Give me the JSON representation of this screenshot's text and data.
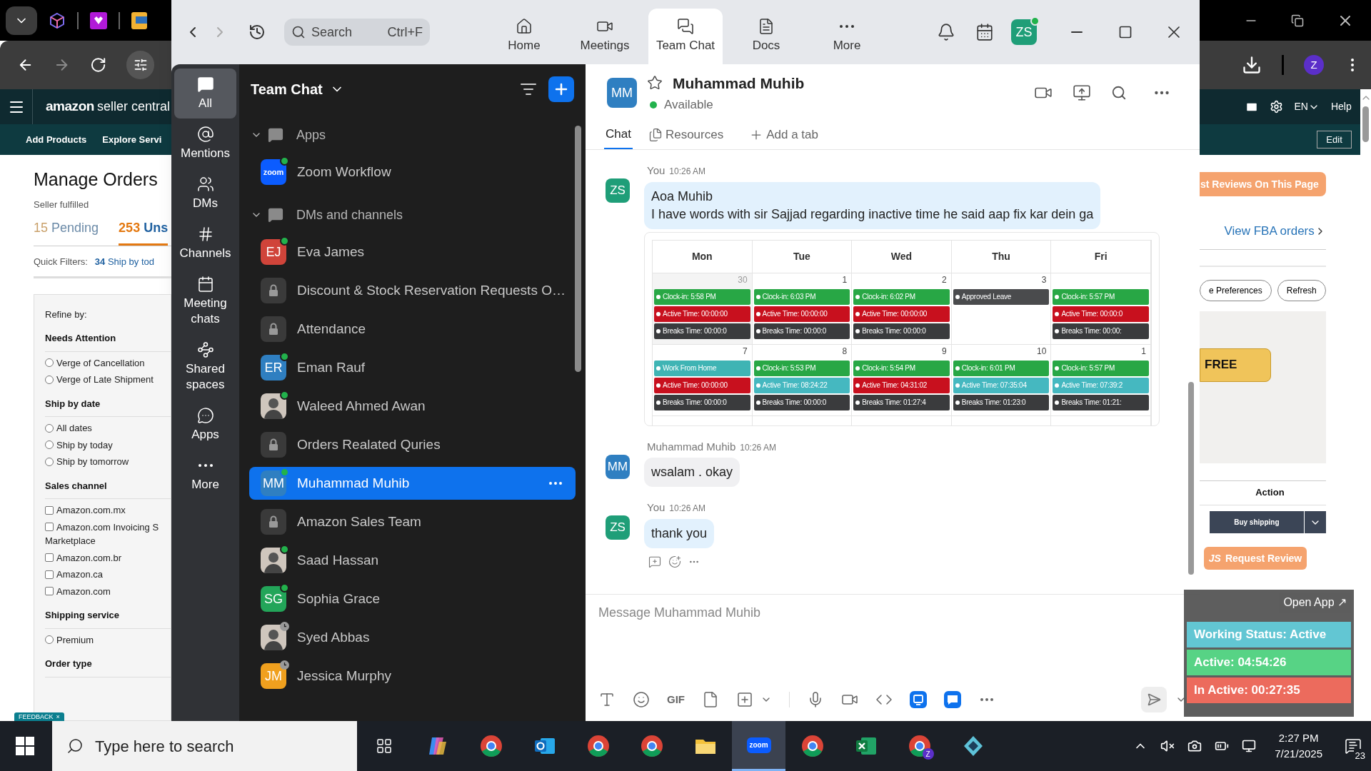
{
  "browser": {
    "brand": "amazon",
    "product": "seller central",
    "nav_links": [
      "Add Products",
      "Explore Servi"
    ],
    "language": "EN",
    "help": "Help",
    "edit_button": "Edit",
    "page_title": "Manage Orders",
    "subtitle": "Seller fulfilled",
    "order_tabs": [
      {
        "count": "15",
        "label": "Pending",
        "selected": false
      },
      {
        "count": "253",
        "label": "Uns",
        "selected": true
      }
    ],
    "quick_filters_label": "Quick Filters:",
    "quick_filter": {
      "count": "34",
      "label": "Ship by tod"
    },
    "refine_title": "Refine by:",
    "filter_groups": [
      {
        "title": "Needs Attention",
        "kind": "radio",
        "options": [
          {
            "label": "Verge of Cancellation",
            "checked": false
          },
          {
            "label": "Verge of Late Shipment",
            "checked": false
          }
        ]
      },
      {
        "title": "Ship by date",
        "kind": "radio",
        "options": [
          {
            "label": "All dates",
            "checked": false
          },
          {
            "label": "Ship by today",
            "checked": false
          },
          {
            "label": "Ship by tomorrow",
            "checked": false
          }
        ]
      },
      {
        "title": "Sales channel",
        "kind": "checkbox",
        "options": [
          {
            "label": "Amazon.com.mx",
            "checked": false
          },
          {
            "label": "Amazon.com Invoicing S",
            "continuation": "Marketplace",
            "checked": false
          },
          {
            "label": "Amazon.com.br",
            "checked": false
          },
          {
            "label": "Amazon.ca",
            "checked": false
          },
          {
            "label": "Amazon.com",
            "checked": false
          }
        ]
      },
      {
        "title": "Shipping service",
        "kind": "radio",
        "options": [
          {
            "label": "Premium",
            "checked": false
          }
        ]
      },
      {
        "title": "Order type"
      }
    ],
    "feedback_tab": {
      "label": "FEEDBACK",
      "close": "×"
    },
    "reviews_button": "st Reviews On This Page",
    "fba_link": "View FBA orders",
    "pill_buttons": [
      "e Preferences",
      "Refresh"
    ],
    "promo_button": "FREE",
    "action_header": "Action",
    "profile_initial": "Z",
    "buy_shipping": "Buy shipping",
    "request_review": {
      "badge": "JS",
      "label": "Request Review"
    }
  },
  "widget": {
    "open_app": "Open App ↗",
    "rows": [
      {
        "label": "Working Status: Active",
        "color": "#62c6d3"
      },
      {
        "label": "Active: 04:54:26",
        "color": "#57d385"
      },
      {
        "label": "In Active: 00:27:35",
        "color": "#ec6b5d"
      }
    ]
  },
  "zoom": {
    "search": {
      "placeholder": "Search",
      "shortcut": "Ctrl+F"
    },
    "nav_tabs": [
      {
        "label": "Home",
        "kind": "home",
        "selected": false
      },
      {
        "label": "Meetings",
        "kind": "meetings",
        "selected": false
      },
      {
        "label": "Team Chat",
        "kind": "team_chat",
        "selected": true
      },
      {
        "label": "Docs",
        "kind": "docs",
        "selected": false
      },
      {
        "label": "More",
        "kind": "more",
        "selected": false
      }
    ],
    "user": {
      "initials": "ZS",
      "online": true
    },
    "rail": [
      {
        "label": "All",
        "kind": "all",
        "selected": true
      },
      {
        "label": "Mentions",
        "kind": "mentions",
        "selected": false
      },
      {
        "label": "DMs",
        "kind": "dms",
        "selected": false
      },
      {
        "label": "Channels",
        "kind": "channels",
        "selected": false
      },
      {
        "label": "Meeting chats",
        "kind": "meeting_chats",
        "selected": false
      },
      {
        "label": "Shared spaces",
        "kind": "shared_spaces",
        "selected": false
      },
      {
        "label": "Apps",
        "kind": "apps",
        "selected": false
      },
      {
        "label": "More",
        "kind": "more",
        "selected": false
      }
    ],
    "list_title": "Team Chat",
    "sections": [
      {
        "title": "Apps",
        "expanded": true,
        "items": [
          {
            "name": "Zoom Workflow",
            "kind": "app",
            "avatar_text": "zoom",
            "online": true,
            "selected": false
          }
        ]
      },
      {
        "title": "DMs and channels",
        "expanded": true,
        "items": [
          {
            "name": "Eva James",
            "kind": "initials",
            "initials": "EJ",
            "color": "#d0443a",
            "online": true,
            "selected": false
          },
          {
            "name": "Discount & Stock Reservation Requests O…",
            "kind": "lock",
            "selected": false
          },
          {
            "name": "Attendance",
            "kind": "lock",
            "selected": false
          },
          {
            "name": "Eman Rauf",
            "kind": "initials",
            "initials": "ER",
            "color": "#2f7fc1",
            "online": true,
            "selected": false
          },
          {
            "name": "Waleed Ahmed Awan",
            "kind": "photo",
            "online": true,
            "selected": false
          },
          {
            "name": "Orders Realated Quries",
            "kind": "lock",
            "selected": false
          },
          {
            "name": "Muhammad Muhib",
            "kind": "initials",
            "initials": "MM",
            "color": "#2f7fc1",
            "online": true,
            "selected": true
          },
          {
            "name": "Amazon Sales Team",
            "kind": "lock",
            "selected": false
          },
          {
            "name": "Saad Hassan",
            "kind": "photo",
            "online": true,
            "selected": false
          },
          {
            "name": "Sophia Grace",
            "kind": "initials",
            "initials": "SG",
            "color": "#23a559",
            "online": true,
            "selected": false
          },
          {
            "name": "Syed Abbas",
            "kind": "photo",
            "away": true,
            "selected": false
          },
          {
            "name": "Jessica Murphy",
            "kind": "initials",
            "initials": "JM",
            "color": "#f0a01e",
            "away": true,
            "selected": false
          }
        ]
      }
    ],
    "chat": {
      "contact": {
        "initials": "MM",
        "color": "#2f7fc1",
        "name": "Muhammad Muhib",
        "status": "Available",
        "starred": false
      },
      "tabs": [
        {
          "label": "Chat",
          "kind": "chat",
          "selected": true
        },
        {
          "label": "Resources",
          "kind": "resources",
          "selected": false
        },
        {
          "label": "Add a tab",
          "kind": "add",
          "selected": false
        }
      ],
      "messages": [
        {
          "sender": "You",
          "time": "10:26 AM",
          "initials": "ZS",
          "color": "#1f9e78",
          "mine": true,
          "lines": [
            "Aoa Muhib",
            "I have words with sir Sajjad regarding inactive time he said aap fix kar dein ga"
          ],
          "attachment": {
            "days": [
              "Mon",
              "Tue",
              "Wed",
              "Thu",
              "Fri"
            ],
            "weeks": [
              [
                {
                  "date": "30",
                  "other_month": true,
                  "events": [
                    {
                      "text": "Clock-in: 5:58 PM",
                      "color": "#28a745"
                    },
                    {
                      "text": "Active Time: 00:00:00",
                      "color": "#c8101e"
                    },
                    {
                      "text": "Breaks Time: 00:00:0",
                      "color": "#3a3b3d"
                    }
                  ]
                },
                {
                  "date": "1",
                  "events": [
                    {
                      "text": "Clock-in: 6:03 PM",
                      "color": "#28a745"
                    },
                    {
                      "text": "Active Time: 00:00:00",
                      "color": "#c8101e"
                    },
                    {
                      "text": "Breaks Time: 00:00:0",
                      "color": "#3a3b3d"
                    }
                  ]
                },
                {
                  "date": "2",
                  "events": [
                    {
                      "text": "Clock-in: 6:02 PM",
                      "color": "#28a745"
                    },
                    {
                      "text": "Active Time: 00:00:00",
                      "color": "#c8101e"
                    },
                    {
                      "text": "Breaks Time: 00:00:0",
                      "color": "#3a3b3d"
                    }
                  ]
                },
                {
                  "date": "3",
                  "events": [
                    {
                      "text": "Approved Leave",
                      "color": "#4a4b4d"
                    }
                  ]
                },
                {
                  "events": [
                    {
                      "text": "Clock-in: 5:57 PM",
                      "color": "#28a745"
                    },
                    {
                      "text": "Active Time: 00:00:0",
                      "color": "#c8101e"
                    },
                    {
                      "text": "Breaks Time: 00:00:",
                      "color": "#3a3b3d"
                    }
                  ]
                }
              ],
              [
                {
                  "date": "7",
                  "events": [
                    {
                      "text": "Work From Home",
                      "color": "#3fb4b4"
                    },
                    {
                      "text": "Active Time: 00:00:00",
                      "color": "#c8101e"
                    },
                    {
                      "text": "Breaks Time: 00:00:0",
                      "color": "#3a3b3d"
                    }
                  ]
                },
                {
                  "date": "8",
                  "events": [
                    {
                      "text": "Clock-in: 5:53 PM",
                      "color": "#28a745"
                    },
                    {
                      "text": "Active Time: 08:24:22",
                      "color": "#45b8c0"
                    },
                    {
                      "text": "Breaks Time: 00:00:0",
                      "color": "#3a3b3d"
                    }
                  ]
                },
                {
                  "date": "9",
                  "events": [
                    {
                      "text": "Clock-in: 5:54 PM",
                      "color": "#28a745"
                    },
                    {
                      "text": "Active Time: 04:31:02",
                      "color": "#c8101e"
                    },
                    {
                      "text": "Breaks Time: 01:27:4",
                      "color": "#3a3b3d"
                    }
                  ]
                },
                {
                  "date": "10",
                  "events": [
                    {
                      "text": "Clock-in: 6:01 PM",
                      "color": "#28a745"
                    },
                    {
                      "text": "Active Time: 07:35:04",
                      "color": "#45b8c0"
                    },
                    {
                      "text": "Breaks Time: 01:23:0",
                      "color": "#3a3b3d"
                    }
                  ]
                },
                {
                  "date": "1",
                  "events": [
                    {
                      "text": "Clock-in: 5:57 PM",
                      "color": "#28a745"
                    },
                    {
                      "text": "Active Time: 07:39:2",
                      "color": "#45b8c0"
                    },
                    {
                      "text": "Breaks Time: 01:21:",
                      "color": "#3a3b3d"
                    }
                  ]
                }
              ]
            ]
          }
        },
        {
          "sender": "Muhammad Muhib",
          "time": "10:26 AM",
          "initials": "MM",
          "color": "#2f7fc1",
          "mine": false,
          "lines": [
            "wsalam . okay"
          ]
        },
        {
          "sender": "You",
          "time": "10:26 AM",
          "initials": "ZS",
          "color": "#1f9e78",
          "mine": true,
          "lines": [
            "thank you"
          ],
          "reactions": true
        }
      ],
      "composer": {
        "placeholder": "Message Muhammad Muhib",
        "gif": "GIF"
      }
    }
  },
  "taskbar": {
    "search_placeholder": "Type here to search",
    "apps": [
      {
        "kind": "taskview",
        "selected": false
      },
      {
        "kind": "copilot",
        "selected": false
      },
      {
        "kind": "chrome",
        "selected": false
      },
      {
        "kind": "outlook",
        "selected": false
      },
      {
        "kind": "chrome",
        "selected": false
      },
      {
        "kind": "chrome",
        "selected": false
      },
      {
        "kind": "explorer",
        "selected": false
      },
      {
        "kind": "zoom",
        "label": "zoom",
        "selected": true
      },
      {
        "kind": "chrome",
        "selected": false
      },
      {
        "kind": "excel",
        "selected": false
      },
      {
        "kind": "chrome",
        "badge": "Z",
        "selected": false
      },
      {
        "kind": "app",
        "selected": false
      }
    ],
    "time": "2:27 PM",
    "date": "7/21/2025",
    "notifications": "23"
  }
}
